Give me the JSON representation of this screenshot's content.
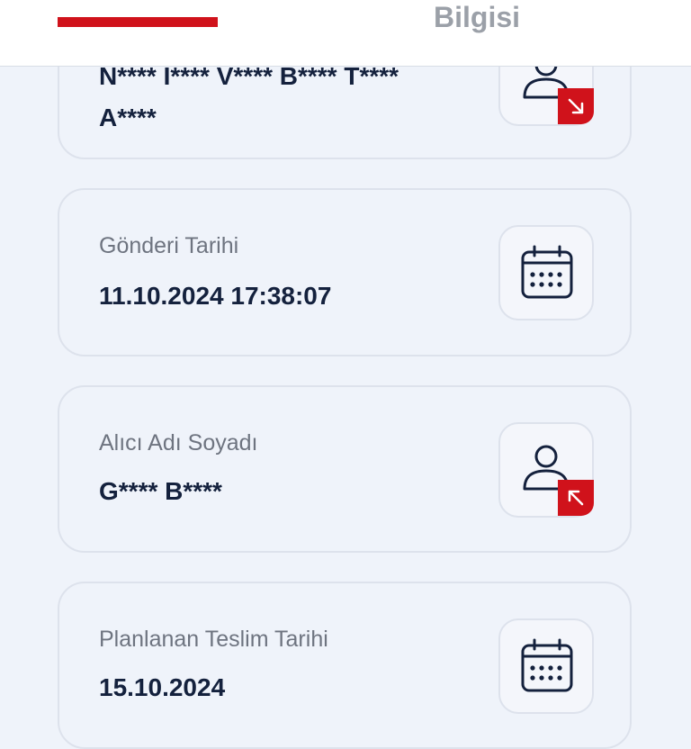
{
  "header": {
    "tab_label": "Bilgisi",
    "accent_color": "#d0121b"
  },
  "cards": [
    {
      "label": "",
      "value_line1": "N**** I**** V**** B**** T****",
      "value_line2": "A****",
      "icon": "person-outgoing-icon"
    },
    {
      "label": "Gönderi Tarihi",
      "value": "11.10.2024 17:38:07",
      "icon": "calendar-icon"
    },
    {
      "label": "Alıcı Adı Soyadı",
      "value": "G**** B****",
      "icon": "person-incoming-icon"
    },
    {
      "label": "Planlanan Teslim Tarihi",
      "value": "15.10.2024",
      "icon": "calendar-icon"
    }
  ]
}
